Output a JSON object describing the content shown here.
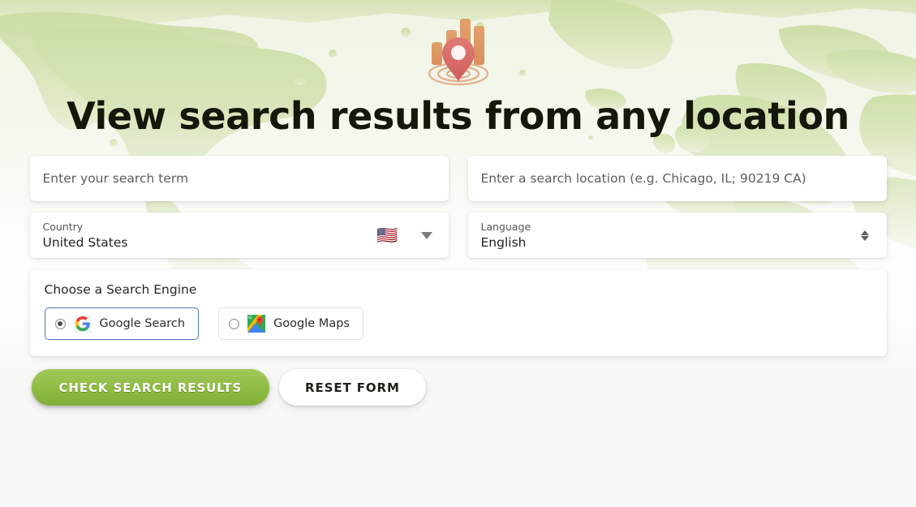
{
  "page": {
    "title": "View search results from any location",
    "logo_icon": "location-pin-bar-chart-logo",
    "background": "world-map-watermark",
    "accent_green": "#8ebb42",
    "title_color": "#14180a",
    "selected_border_color": "#4a79b8"
  },
  "search_term_field": {
    "name": "search-term-input",
    "placeholder": "Enter your search term",
    "value": ""
  },
  "location_field": {
    "name": "search-location-input",
    "placeholder": "Enter a search location (e.g. Chicago, IL; 90219 CA)",
    "value": ""
  },
  "country_select": {
    "label": "Country",
    "value": "United States",
    "flag": "🇺🇸",
    "flag_icon": "us-flag-icon",
    "chevron_icon": "chevron-down-icon"
  },
  "language_select": {
    "label": "Language",
    "value": "English",
    "stepper_icon": "up-down-arrows-icon"
  },
  "search_engine": {
    "heading": "Choose a Search Engine",
    "options": [
      {
        "label": "Google Search",
        "icon": "google-g-icon",
        "selected": true
      },
      {
        "label": "Google Maps",
        "icon": "google-maps-icon",
        "selected": false
      }
    ]
  },
  "actions": {
    "primary_label": "CHECK SEARCH RESULTS",
    "secondary_label": "RESET FORM"
  }
}
